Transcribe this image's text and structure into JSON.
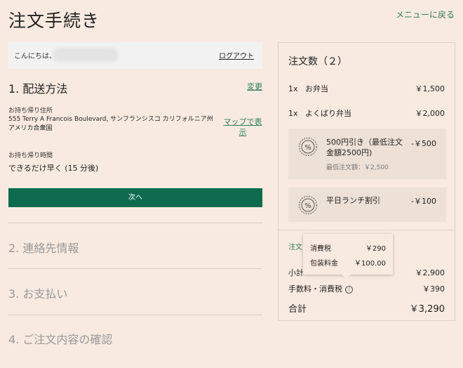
{
  "page": {
    "title": "注文手続き",
    "back_link": "メニューに戻る"
  },
  "greeting": {
    "text": "こんにちは、",
    "logout": "ログアウト"
  },
  "delivery": {
    "number": "1.",
    "title": "配送方法",
    "change": "変更",
    "address_label": "お持ち帰り住所",
    "address": "555 Terry A Francois Boulevard, サンフランシスコ カリフォルニア州 アメリカ合衆国",
    "map_link": "マップで表示",
    "time_label": "お持ち帰り時間",
    "time_value": "できるだけ早く (15 分後)",
    "next_button": "次へ"
  },
  "steps": [
    {
      "number": "2.",
      "title": "連絡先情報"
    },
    {
      "number": "3.",
      "title": "お支払い"
    },
    {
      "number": "4.",
      "title": "ご注文内容の確認"
    }
  ],
  "order": {
    "title": "注文数（２）",
    "items": [
      {
        "qty": "1x",
        "name": "お弁当",
        "price": "￥1,500"
      },
      {
        "qty": "1x",
        "name": "よくばり弁当",
        "price": "￥2,000"
      }
    ],
    "discounts": [
      {
        "name": "500円引き（最低注文金額2500円)",
        "amount": "-￥500",
        "sub": "最低注文額：￥2,500",
        "icon": "percent-badge-icon"
      },
      {
        "name": "平日ランチ割引",
        "amount": "-￥100",
        "icon": "percent-badge-icon"
      }
    ],
    "order_link_partial": "注文",
    "subtotal_label": "小計",
    "subtotal": "￥2,900",
    "fees_label": "手数料・消費税",
    "fees": "￥390",
    "total_label": "合計",
    "total": "￥3,290"
  },
  "tooltip": {
    "rows": [
      {
        "label": "消費税",
        "value": "￥290"
      },
      {
        "label": "包装料金",
        "value": "￥100.00"
      }
    ]
  },
  "colors": {
    "accent": "#0e6b4e",
    "link": "#2e7d5e",
    "background": "#f8eae0"
  }
}
